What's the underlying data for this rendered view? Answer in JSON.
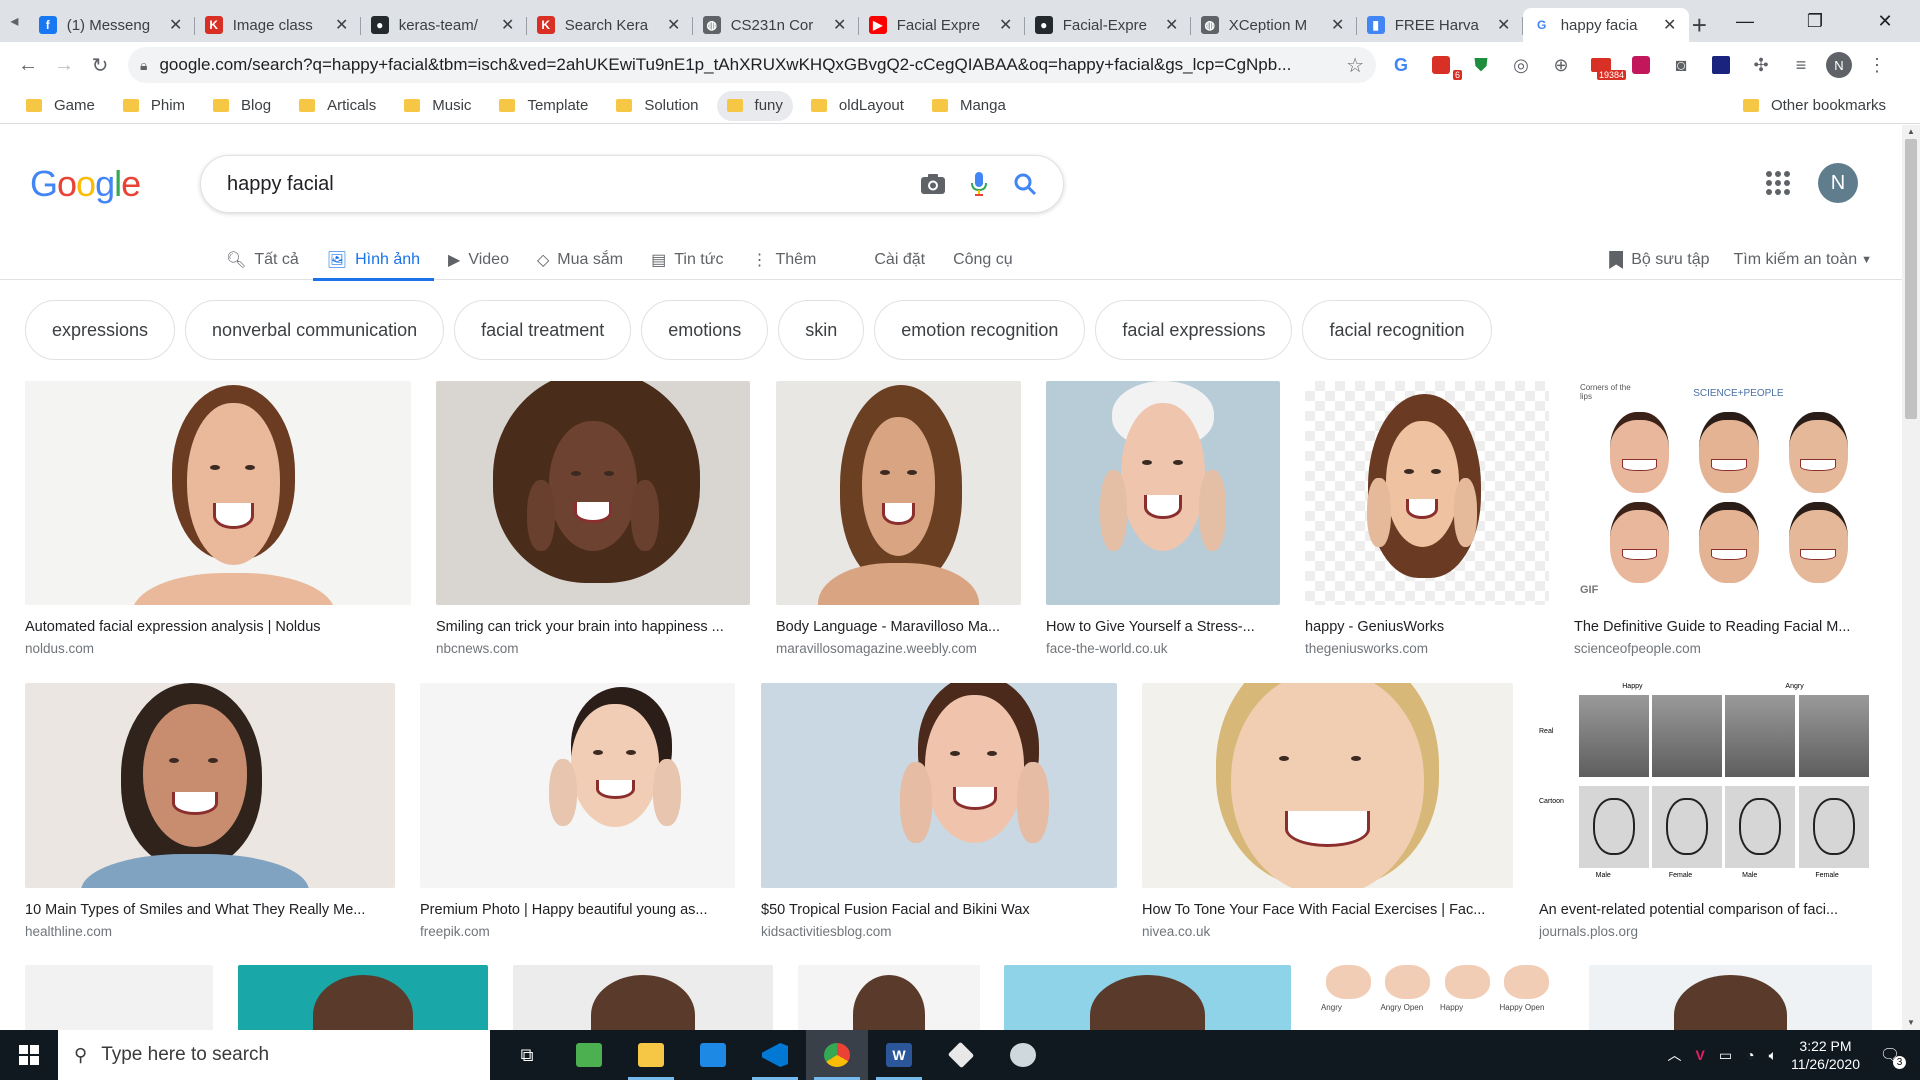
{
  "browser": {
    "tabs": [
      {
        "title": "(1) Messeng",
        "favicon": "facebook-icon",
        "color": "#1877f2"
      },
      {
        "title": "Image class",
        "favicon": "kaggle-k-icon",
        "color": "#d93025"
      },
      {
        "title": "keras-team/",
        "favicon": "github-icon",
        "color": "#24292e"
      },
      {
        "title": "Search Kera",
        "favicon": "kaggle-k-icon",
        "color": "#d93025"
      },
      {
        "title": "CS231n Cor",
        "favicon": "globe-icon",
        "color": "#5f6368"
      },
      {
        "title": "Facial Expre",
        "favicon": "youtube-icon",
        "color": "#ff0000"
      },
      {
        "title": "Facial-Expre",
        "favicon": "github-icon",
        "color": "#24292e"
      },
      {
        "title": "XCeption M",
        "favicon": "globe-icon",
        "color": "#5f6368"
      },
      {
        "title": "FREE Harva",
        "favicon": "bookmark-icon",
        "color": "#4285f4"
      },
      {
        "title": "happy facia",
        "favicon": "google-g-icon",
        "color": "#4285f4",
        "active": true
      }
    ],
    "url": "google.com/search?q=happy+facial&tbm=isch&ved=2ahUKEwiTu9nE1p_tAhXRUXwKHQxGBvgQ2-cCegQIABAA&oq=happy+facial&gs_lcp=CgNpb...",
    "profile_letter": "N",
    "ext_badges": {
      "a": "6",
      "b": "19384"
    },
    "bookmarks": [
      "Game",
      "Phim",
      "Blog",
      "Articals",
      "Music",
      "Template",
      "Solution",
      "funy",
      "oldLayout",
      "Manga"
    ],
    "other_bookmarks": "Other bookmarks"
  },
  "google": {
    "logo": "Google",
    "query": "happy facial",
    "avatar_letter": "N",
    "tabs": [
      {
        "label": "Tất cả",
        "icon": "search-icon"
      },
      {
        "label": "Hình ảnh",
        "icon": "image-icon",
        "active": true
      },
      {
        "label": "Video",
        "icon": "video-icon"
      },
      {
        "label": "Mua sắm",
        "icon": "tag-icon"
      },
      {
        "label": "Tin tức",
        "icon": "news-icon"
      },
      {
        "label": "Thêm",
        "icon": "more-vert-icon"
      }
    ],
    "settings_label": "Cài đặt",
    "tools_label": "Công cụ",
    "collections_label": "Bộ sưu tập",
    "safesearch_label": "Tìm kiếm an toàn",
    "chips": [
      "expressions",
      "nonverbal communication",
      "facial treatment",
      "emotions",
      "skin",
      "emotion recognition",
      "facial expressions",
      "facial recognition"
    ],
    "results_row1": [
      {
        "caption": "Automated facial expression analysis | Noldus",
        "domain": "noldus.com"
      },
      {
        "caption": "Smiling can trick your brain into happiness ...",
        "domain": "nbcnews.com"
      },
      {
        "caption": "Body Language - Maravilloso Ma...",
        "domain": "maravillosomagazine.weebly.com"
      },
      {
        "caption": "How to Give Yourself a Stress-...",
        "domain": "face-the-world.co.uk"
      },
      {
        "caption": "happy - GeniusWorks",
        "domain": "thegeniusworks.com"
      },
      {
        "caption": "The Definitive Guide to Reading Facial M...",
        "domain": "scienceofpeople.com"
      }
    ],
    "results_row2": [
      {
        "caption": "10 Main Types of Smiles and What They Really Me...",
        "domain": "healthline.com"
      },
      {
        "caption": "Premium Photo | Happy beautiful young as...",
        "domain": "freepik.com"
      },
      {
        "caption": "$50 Tropical Fusion Facial and Bikini Wax",
        "domain": "kidsactivitiesblog.com"
      },
      {
        "caption": "How To Tone Your Face With Facial Exercises | Fac...",
        "domain": "nivea.co.uk"
      },
      {
        "caption": "An event-related potential comparison of faci...",
        "domain": "journals.plos.org"
      }
    ],
    "thumb_labels": {
      "science_people": "SCIENCE+PEOPLE",
      "corners": "Corners of the lips",
      "gif": "GIF",
      "plos_cols": [
        "Happy",
        "Angry"
      ],
      "plos_rows": [
        "Real",
        "Cartoon"
      ],
      "plos_bottom": [
        "Male",
        "Female",
        "Male",
        "Female"
      ],
      "emotion_labels": [
        "Angry",
        "Angry Open",
        "Happy",
        "Happy Open"
      ]
    }
  },
  "taskbar": {
    "search_placeholder": "Type here to search",
    "time": "3:22 PM",
    "date": "11/26/2020",
    "notifications": "3"
  }
}
